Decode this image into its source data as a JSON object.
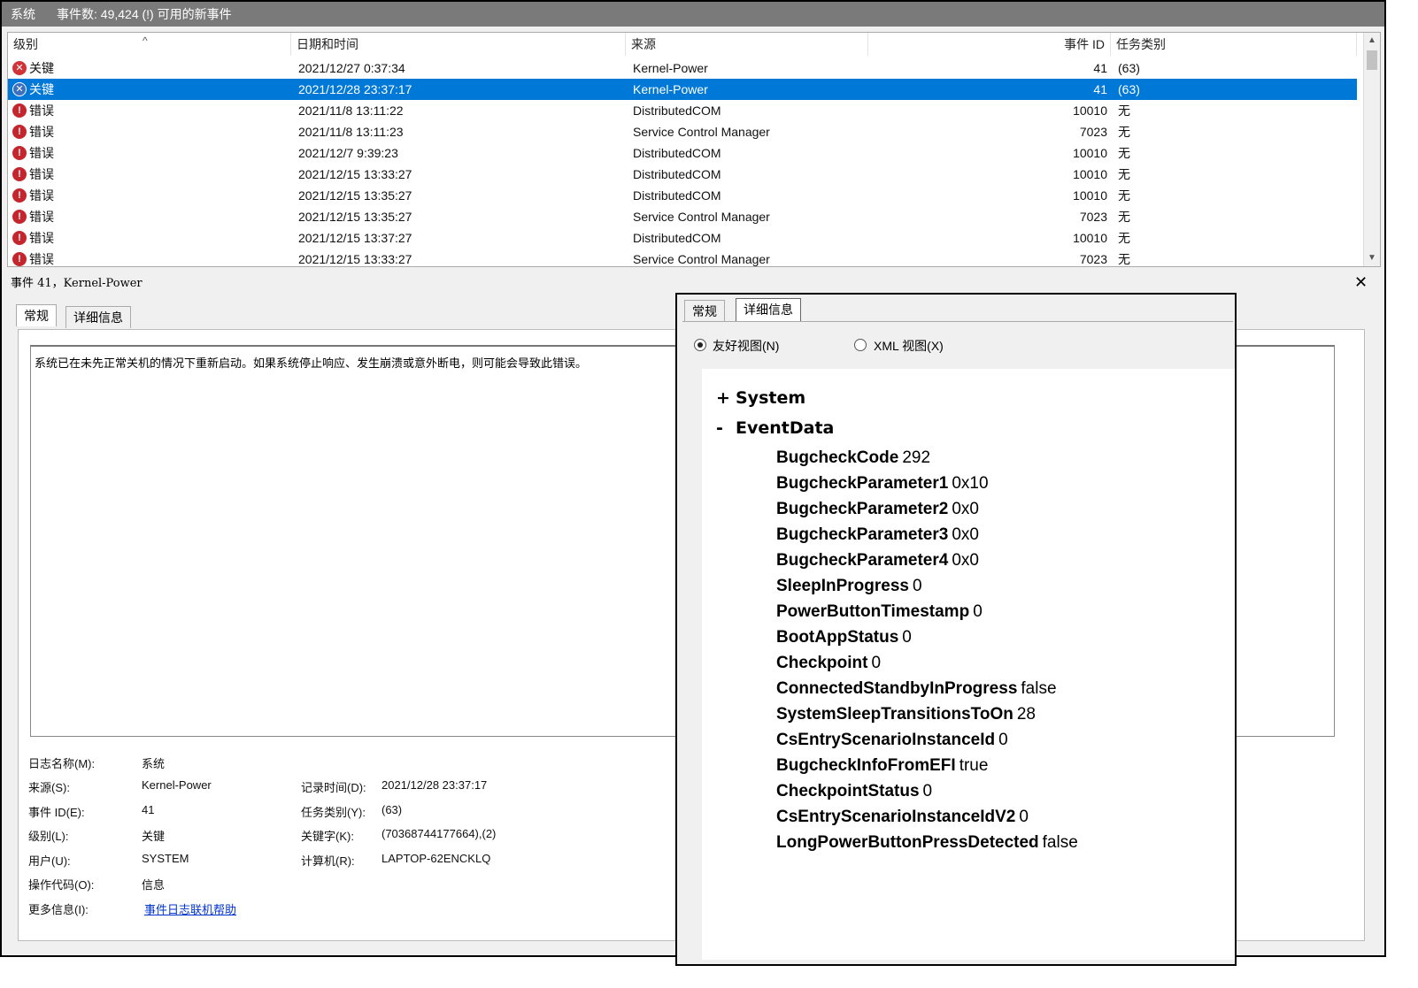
{
  "titlebar": {
    "log": "系统",
    "summary": "事件数: 49,424 (!) 可用的新事件"
  },
  "columns": {
    "level": "级别",
    "datetime": "日期和时间",
    "source": "来源",
    "event_id": "事件 ID",
    "task": "任务类别"
  },
  "events": [
    {
      "level": "关键",
      "icon": "critical-icon",
      "datetime": "2021/12/27 0:37:34",
      "source": "Kernel-Power",
      "event_id": "41",
      "task": "(63)"
    },
    {
      "level": "关键",
      "icon": "critical-icon",
      "datetime": "2021/12/28 23:37:17",
      "source": "Kernel-Power",
      "event_id": "41",
      "task": "(63)"
    },
    {
      "level": "错误",
      "icon": "error-icon",
      "datetime": "2021/11/8 13:11:22",
      "source": "DistributedCOM",
      "event_id": "10010",
      "task": "无"
    },
    {
      "level": "错误",
      "icon": "error-icon",
      "datetime": "2021/11/8 13:11:23",
      "source": "Service Control Manager",
      "event_id": "7023",
      "task": "无"
    },
    {
      "level": "错误",
      "icon": "error-icon",
      "datetime": "2021/12/7 9:39:23",
      "source": "DistributedCOM",
      "event_id": "10010",
      "task": "无"
    },
    {
      "level": "错误",
      "icon": "error-icon",
      "datetime": "2021/12/15 13:33:27",
      "source": "DistributedCOM",
      "event_id": "10010",
      "task": "无"
    },
    {
      "level": "错误",
      "icon": "error-icon",
      "datetime": "2021/12/15 13:35:27",
      "source": "DistributedCOM",
      "event_id": "10010",
      "task": "无"
    },
    {
      "level": "错误",
      "icon": "error-icon",
      "datetime": "2021/12/15 13:35:27",
      "source": "Service Control Manager",
      "event_id": "7023",
      "task": "无"
    },
    {
      "level": "错误",
      "icon": "error-icon",
      "datetime": "2021/12/15 13:37:27",
      "source": "DistributedCOM",
      "event_id": "10010",
      "task": "无"
    },
    {
      "level": "错误",
      "icon": "error-icon",
      "datetime": "2021/12/15 13:33:27",
      "source": "Service Control Manager",
      "event_id": "7023",
      "task": "无"
    }
  ],
  "detail": {
    "header": "事件 41，Kernel-Power",
    "tabs": [
      "常规",
      "详细信息"
    ],
    "description": "系统已在未先正常关机的情况下重新启动。如果系统停止响应、发生崩溃或意外断电，则可能会导致此错误。",
    "labels": {
      "log_name": "日志名称(M):",
      "source": "来源(S):",
      "event_id": "事件 ID(E):",
      "level": "级别(L):",
      "user": "用户(U):",
      "opcode": "操作代码(O):",
      "more_info": "更多信息(I):",
      "logged": "记录时间(D):",
      "task": "任务类别(Y):",
      "keywords": "关键字(K):",
      "computer": "计算机(R):"
    },
    "values": {
      "log_name": "系统",
      "source": "Kernel-Power",
      "event_id": "41",
      "level": "关键",
      "user": "SYSTEM",
      "opcode": "信息",
      "more_info": "事件日志联机帮助",
      "logged": "2021/12/28 23:37:17",
      "task": "(63)",
      "keywords": "(70368744177664),(2)",
      "computer": "LAPTOP-62ENCKLQ"
    }
  },
  "xml": {
    "tabs": [
      "常规",
      "详细信息"
    ],
    "view_friendly": "友好视图(N)",
    "view_xml": "XML 视图(X)",
    "system_toggle": "+",
    "system_label": "System",
    "eventdata_toggle": "-",
    "eventdata_label": "EventData",
    "fields": [
      {
        "k": "BugcheckCode",
        "v": "292"
      },
      {
        "k": "BugcheckParameter1",
        "v": "0x10"
      },
      {
        "k": "BugcheckParameter2",
        "v": "0x0"
      },
      {
        "k": "BugcheckParameter3",
        "v": "0x0"
      },
      {
        "k": "BugcheckParameter4",
        "v": "0x0"
      },
      {
        "k": "SleepInProgress",
        "v": "0"
      },
      {
        "k": "PowerButtonTimestamp",
        "v": "0"
      },
      {
        "k": "BootAppStatus",
        "v": "0"
      },
      {
        "k": "Checkpoint",
        "v": "0"
      },
      {
        "k": "ConnectedStandbyInProgress",
        "v": "false"
      },
      {
        "k": "SystemSleepTransitionsToOn",
        "v": "28"
      },
      {
        "k": "CsEntryScenarioInstanceId",
        "v": "0"
      },
      {
        "k": "BugcheckInfoFromEFI",
        "v": "true"
      },
      {
        "k": "CheckpointStatus",
        "v": "0"
      },
      {
        "k": "CsEntryScenarioInstanceIdV2",
        "v": "0"
      },
      {
        "k": "LongPowerButtonPressDetected",
        "v": "false"
      }
    ]
  }
}
